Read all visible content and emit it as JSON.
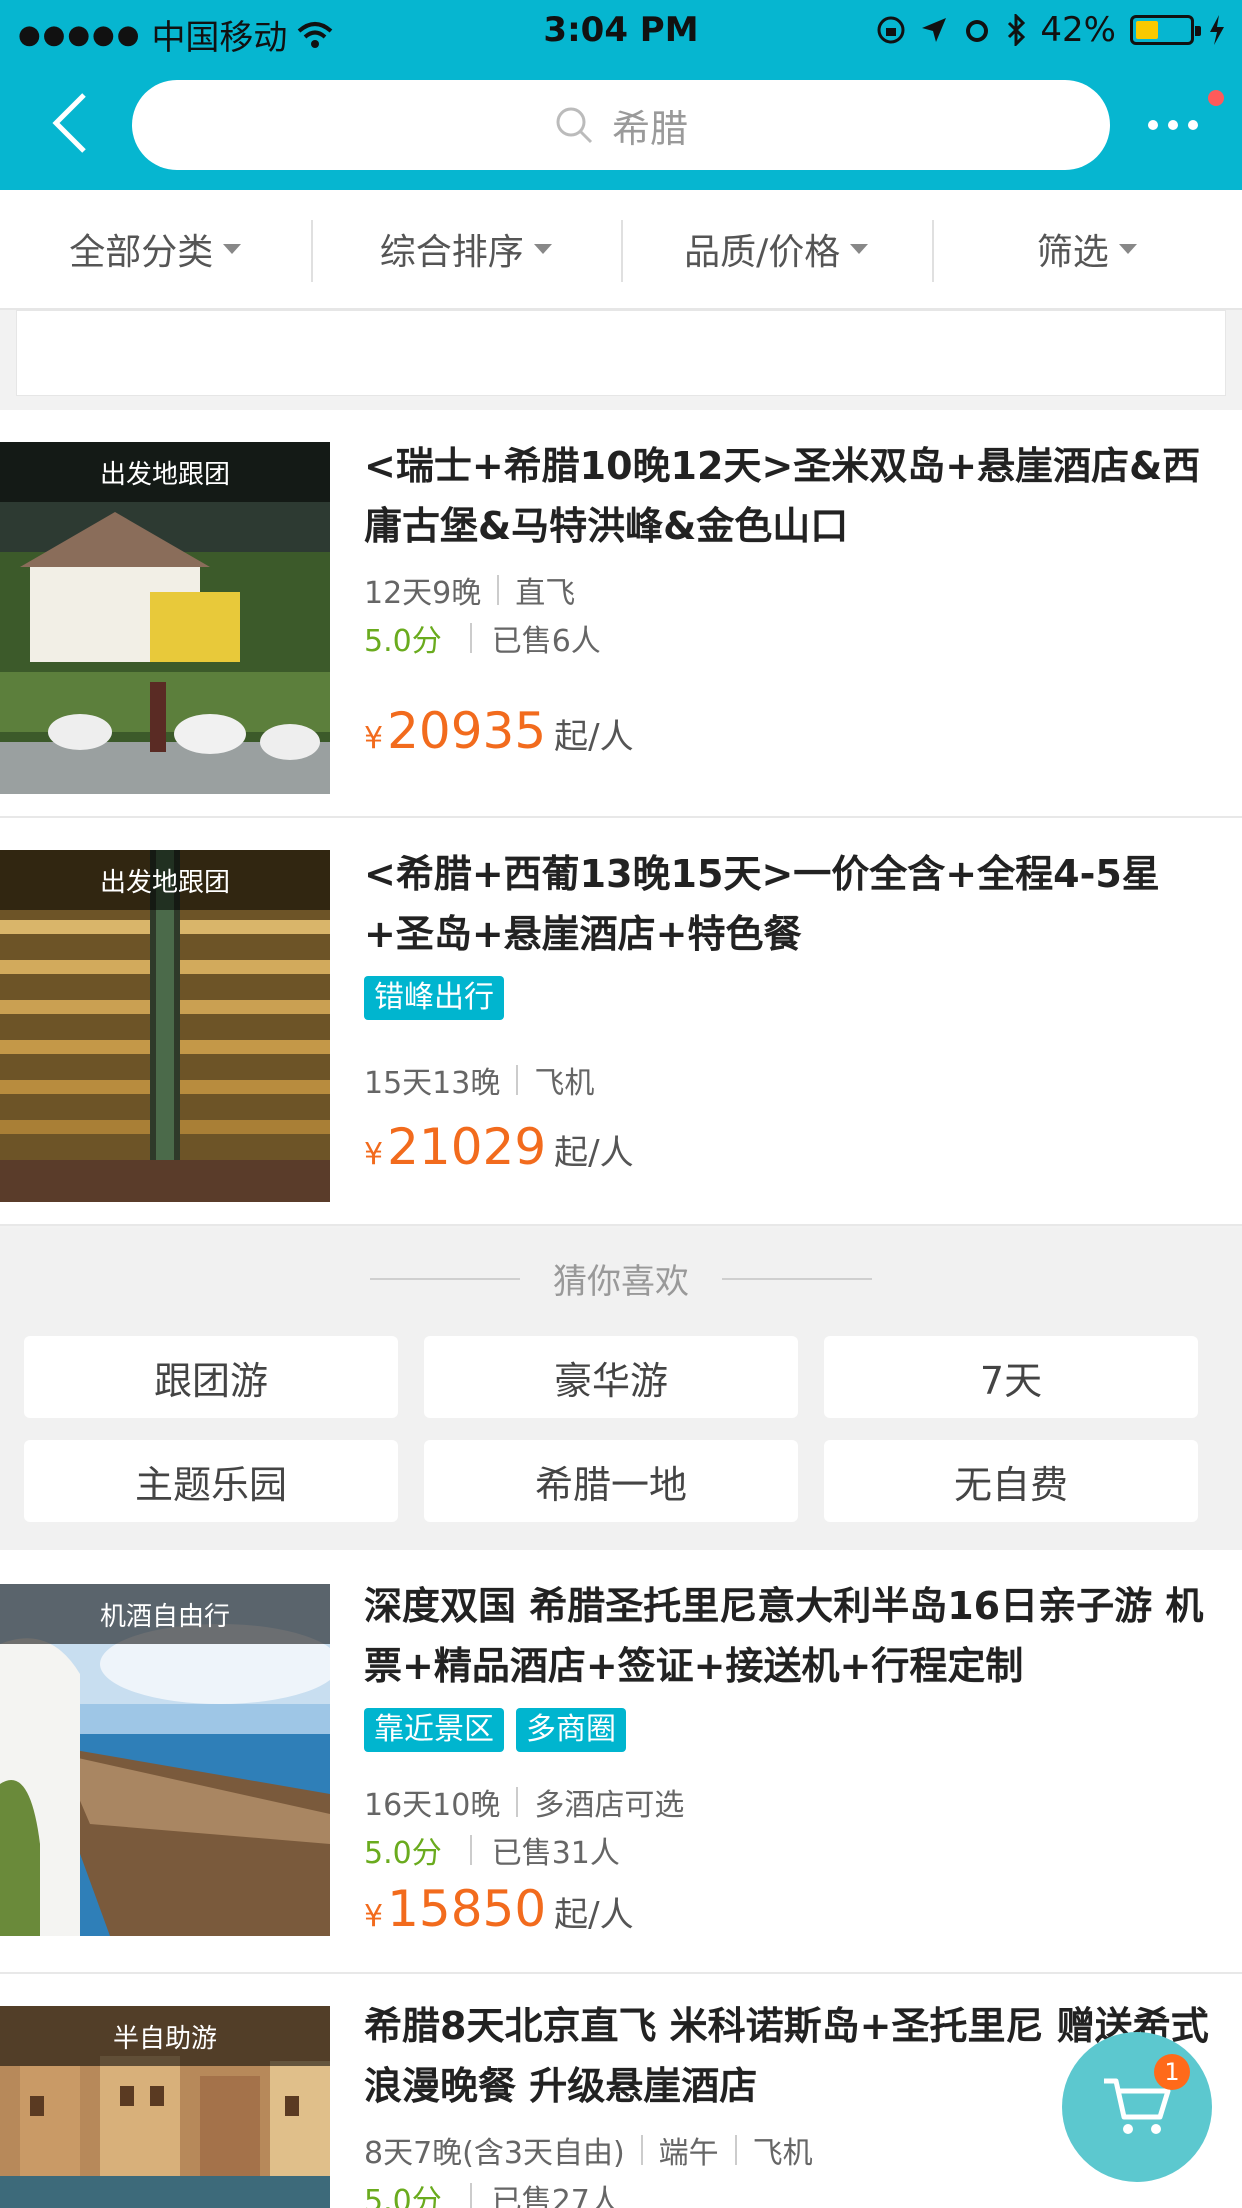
{
  "status_bar": {
    "carrier": "中国移动",
    "time": "3:04 PM",
    "battery_percent": "42%"
  },
  "header": {
    "search_placeholder": "希腊",
    "has_notification_dot": true
  },
  "filters": [
    {
      "label": "全部分类"
    },
    {
      "label": "综合排序"
    },
    {
      "label": "品质/价格"
    },
    {
      "label": "筛选"
    }
  ],
  "products": [
    {
      "tag": "出发地跟团",
      "title": "<瑞士+希腊10晚12天>圣米双岛+悬崖酒店&西庸古堡&马特洪峰&金色山口",
      "meta": [
        "12天9晚",
        "直飞"
      ],
      "score": "5.0分",
      "sold": "已售6人",
      "price_currency": "¥",
      "price": "20935",
      "price_unit": "起/人"
    },
    {
      "tag": "出发地跟团",
      "title": "<希腊+西葡13晚15天>一价全含+全程4-5星+圣岛+悬崖酒店+特色餐",
      "badges": [
        "错峰出行"
      ],
      "meta": [
        "15天13晚",
        "飞机"
      ],
      "price_currency": "¥",
      "price": "21029",
      "price_unit": "起/人"
    },
    {
      "tag": "机酒自由行",
      "title": "深度双国 希腊圣托里尼意大利半岛16日亲子游 机票+精品酒店+签证+接送机+行程定制",
      "badges": [
        "靠近景区",
        "多商圈"
      ],
      "meta": [
        "16天10晚",
        "多酒店可选"
      ],
      "score": "5.0分",
      "sold": "已售31人",
      "price_currency": "¥",
      "price": "15850",
      "price_unit": "起/人"
    },
    {
      "tag": "半自助游",
      "title": "希腊8天北京直飞 米科诺斯岛+圣托里尼 赠送希式浪漫晚餐 升级悬崖酒店",
      "meta": [
        "8天7晚(含3天自由)",
        "端午",
        "飞机"
      ],
      "score": "5.0分",
      "sold": "已售27人"
    }
  ],
  "guess": {
    "title": "猜你喜欢",
    "chips": [
      "跟团游",
      "豪华游",
      "7天",
      "主题乐园",
      "希腊一地",
      "无自费"
    ]
  },
  "cart": {
    "count": "1"
  },
  "colors": {
    "accent": "#06b6d0",
    "price": "#f26b1d",
    "score": "#6aab1e"
  }
}
